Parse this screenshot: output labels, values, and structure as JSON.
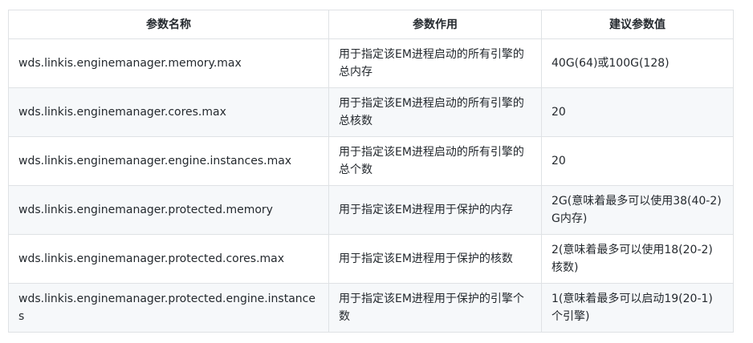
{
  "table": {
    "headers": [
      "参数名称",
      "参数作用",
      "建议参数值"
    ],
    "rows": [
      {
        "name": "wds.linkis.enginemanager.memory.max",
        "purpose": "用于指定该EM进程启动的所有引擎的总内存",
        "value": "40G(64)或100G(128)"
      },
      {
        "name": "wds.linkis.enginemanager.cores.max",
        "purpose": "用于指定该EM进程启动的所有引擎的总核数",
        "value": "20"
      },
      {
        "name": "wds.linkis.enginemanager.engine.instances.max",
        "purpose": "用于指定该EM进程启动的所有引擎的总个数",
        "value": "20"
      },
      {
        "name": "wds.linkis.enginemanager.protected.memory",
        "purpose": "用于指定该EM进程用于保护的内存",
        "value": "2G(意味着最多可以使用38(40-2)G内存)"
      },
      {
        "name": "wds.linkis.enginemanager.protected.cores.max",
        "purpose": "用于指定该EM进程用于保护的核数",
        "value": "2(意味着最多可以使用18(20-2)核数)"
      },
      {
        "name": "wds.linkis.enginemanager.protected.engine.instances",
        "purpose": "用于指定该EM进程用于保护的引擎个数",
        "value": "1(意味着最多可以启动19(20-1)个引擎)"
      }
    ]
  }
}
